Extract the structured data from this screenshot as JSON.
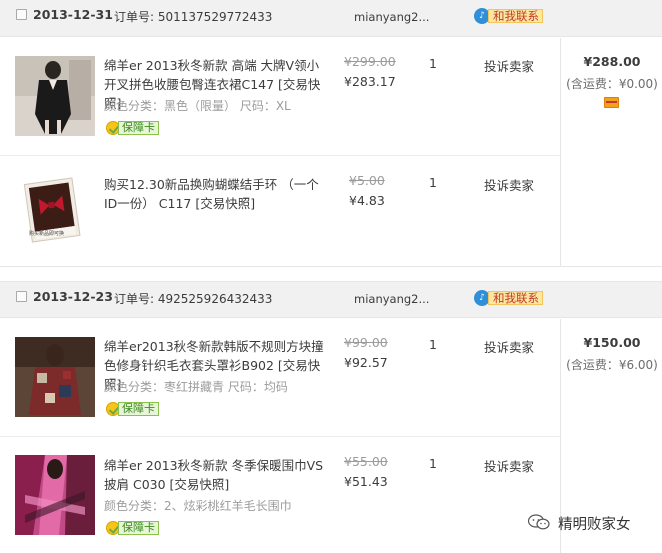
{
  "orders": [
    {
      "date": "2013-12-31",
      "order_no_label": "订单号:",
      "order_no": "501137529772433",
      "seller": "mianyang2...",
      "contact_label": "和我联系",
      "total": "¥288.00",
      "shipping": "(含运费：¥0.00)",
      "items": [
        {
          "title": "绵羊er 2013秋冬新款 高端 大牌V领小开叉拼色收腰包臀连衣裙C147 [交易快照]",
          "sku": "颜色分类：黑色（限量）   尺码：XL",
          "badge": "保障卡",
          "old_price": "¥299.00",
          "price": "¥283.17",
          "qty": "1",
          "action": "投诉卖家"
        },
        {
          "title": "购买12.30新品换购蝴蝶结手环 （一个ID一份） C117 [交易快照]",
          "sku": "",
          "badge": "",
          "old_price": "¥5.00",
          "price": "¥4.83",
          "qty": "1",
          "action": "投诉卖家"
        }
      ]
    },
    {
      "date": "2013-12-23",
      "order_no_label": "订单号:",
      "order_no": "492525926432433",
      "seller": "mianyang2...",
      "contact_label": "和我联系",
      "total": "¥150.00",
      "shipping": "(含运费：¥6.00)",
      "items": [
        {
          "title": "绵羊er2013秋冬新款韩版不规则方块撞色修身针织毛衣套头罩衫B902 [交易快照]",
          "sku": "颜色分类：枣红拼藏青   尺码：均码",
          "badge": "保障卡",
          "old_price": "¥99.00",
          "price": "¥92.57",
          "qty": "1",
          "action": "投诉卖家"
        },
        {
          "title": "绵羊er 2013秋冬新款 冬季保暖围巾VS披肩 C030 [交易快照]",
          "sku": "颜色分类：2、炫彩桃红羊毛长围巾",
          "badge": "保障卡",
          "old_price": "¥55.00",
          "price": "¥51.43",
          "qty": "1",
          "action": "投诉卖家"
        }
      ]
    }
  ],
  "watermark": "精明败家女",
  "colors": {
    "header_bg": "#f1f1f1",
    "contact_bg": "#fde7a0",
    "contact_text": "#c0392b",
    "badge_green": "#3d8b1e",
    "muted": "#9c9c9c"
  }
}
